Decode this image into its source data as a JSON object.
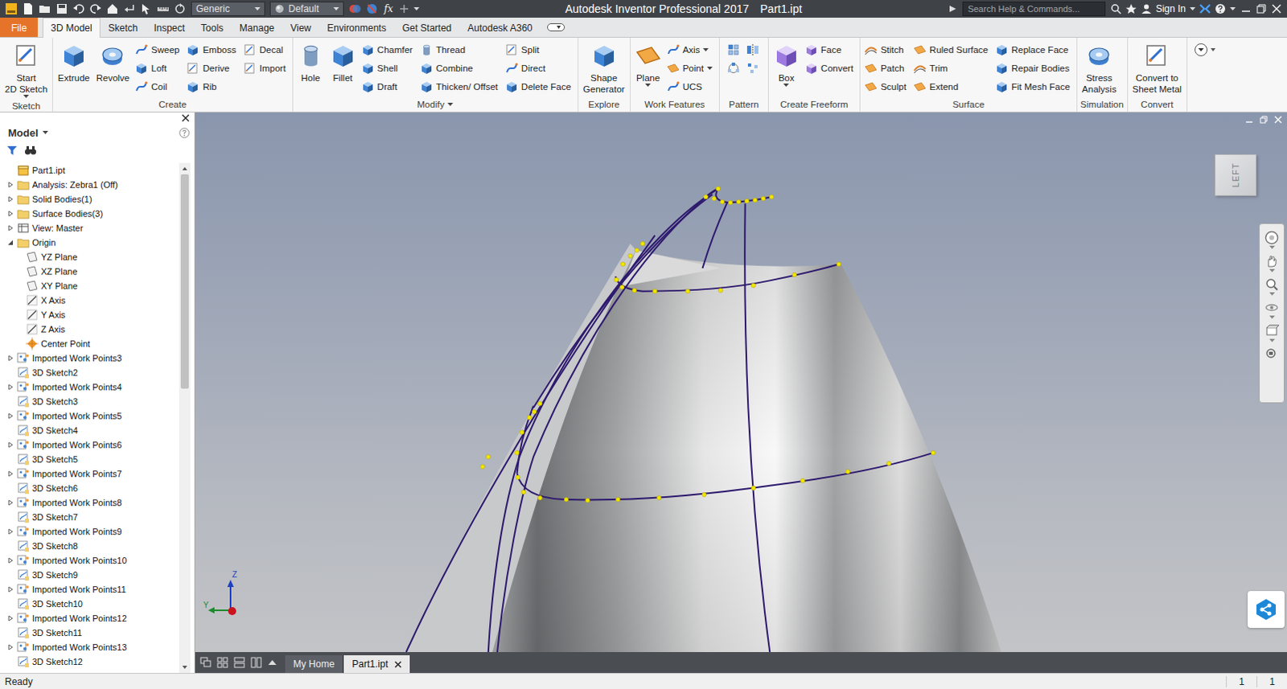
{
  "window": {
    "title": "Autodesk Inventor Professional 2017",
    "document": "Part1.ipt"
  },
  "quick_access": {
    "appearance": "Generic",
    "material": "Default",
    "formula": "fx"
  },
  "search": {
    "placeholder": "Search Help & Commands..."
  },
  "account": {
    "sign_in": "Sign In"
  },
  "menu_tabs": [
    {
      "label": "File",
      "kind": "file",
      "selected": false
    },
    {
      "label": "3D Model",
      "kind": "tab",
      "selected": true
    },
    {
      "label": "Sketch",
      "kind": "tab",
      "selected": false
    },
    {
      "label": "Inspect",
      "kind": "tab",
      "selected": false
    },
    {
      "label": "Tools",
      "kind": "tab",
      "selected": false
    },
    {
      "label": "Manage",
      "kind": "tab",
      "selected": false
    },
    {
      "label": "View",
      "kind": "tab",
      "selected": false
    },
    {
      "label": "Environments",
      "kind": "tab",
      "selected": false
    },
    {
      "label": "Get Started",
      "kind": "tab",
      "selected": false
    },
    {
      "label": "Autodesk A360",
      "kind": "tab",
      "selected": false
    }
  ],
  "ribbon": {
    "panels": [
      {
        "title": "Sketch",
        "menu": false,
        "groups": [
          {
            "kind": "large",
            "tools": [
              {
                "lines": [
                  "Start",
                  "2D Sketch"
                ],
                "dropdown": true
              }
            ]
          }
        ]
      },
      {
        "title": "Create",
        "menu": false,
        "groups": [
          {
            "kind": "large",
            "tools": [
              {
                "lines": [
                  "Extrude"
                ],
                "dropdown": false
              }
            ]
          },
          {
            "kind": "large",
            "tools": [
              {
                "lines": [
                  "Revolve"
                ],
                "dropdown": false
              }
            ]
          },
          {
            "kind": "column",
            "tools": [
              {
                "label": "Sweep",
                "dropdown": false
              },
              {
                "label": "Loft",
                "dropdown": false
              },
              {
                "label": "Coil",
                "dropdown": false
              }
            ]
          },
          {
            "kind": "column",
            "tools": [
              {
                "label": "Emboss",
                "dropdown": false
              },
              {
                "label": "Derive",
                "dropdown": false
              },
              {
                "label": "Rib",
                "dropdown": false
              }
            ]
          },
          {
            "kind": "column",
            "tools": [
              {
                "label": "Decal",
                "dropdown": false
              },
              {
                "label": "Import",
                "dropdown": false
              }
            ]
          }
        ]
      },
      {
        "title": "Modify",
        "menu": true,
        "groups": [
          {
            "kind": "large",
            "tools": [
              {
                "lines": [
                  "Hole"
                ],
                "dropdown": false
              }
            ]
          },
          {
            "kind": "large",
            "tools": [
              {
                "lines": [
                  "Fillet"
                ],
                "dropdown": false
              }
            ]
          },
          {
            "kind": "column",
            "tools": [
              {
                "label": "Chamfer",
                "dropdown": false
              },
              {
                "label": "Shell",
                "dropdown": false
              },
              {
                "label": "Draft",
                "dropdown": false
              }
            ]
          },
          {
            "kind": "column",
            "tools": [
              {
                "label": "Thread",
                "dropdown": false
              },
              {
                "label": "Combine",
                "dropdown": false
              },
              {
                "label": "Thicken/ Offset",
                "dropdown": false
              }
            ]
          },
          {
            "kind": "column",
            "tools": [
              {
                "label": "Split",
                "dropdown": false
              },
              {
                "label": "Direct",
                "dropdown": false
              },
              {
                "label": "Delete Face",
                "dropdown": false
              }
            ]
          }
        ]
      },
      {
        "title": "Explore",
        "menu": false,
        "groups": [
          {
            "kind": "large",
            "tools": [
              {
                "lines": [
                  "Shape",
                  "Generator"
                ],
                "dropdown": false
              }
            ]
          }
        ]
      },
      {
        "title": "Work Features",
        "menu": false,
        "groups": [
          {
            "kind": "large",
            "tools": [
              {
                "lines": [
                  "Plane"
                ],
                "dropdown": true
              }
            ]
          },
          {
            "kind": "column",
            "tools": [
              {
                "label": "Axis",
                "dropdown": true
              },
              {
                "label": "Point",
                "dropdown": true
              },
              {
                "label": "UCS",
                "dropdown": false
              }
            ]
          }
        ]
      },
      {
        "title": "Pattern",
        "menu": false,
        "groups": [
          {
            "kind": "icons",
            "tools": []
          }
        ]
      },
      {
        "title": "Create Freeform",
        "menu": false,
        "groups": [
          {
            "kind": "large",
            "tools": [
              {
                "lines": [
                  "Box"
                ],
                "dropdown": true
              }
            ]
          },
          {
            "kind": "column",
            "tools": [
              {
                "label": "Face",
                "dropdown": false
              },
              {
                "label": "Convert",
                "dropdown": false
              }
            ]
          }
        ]
      },
      {
        "title": "Surface",
        "menu": false,
        "groups": [
          {
            "kind": "column",
            "tools": [
              {
                "label": "Stitch",
                "dropdown": false
              },
              {
                "label": "Patch",
                "dropdown": false
              },
              {
                "label": "Sculpt",
                "dropdown": false
              }
            ]
          },
          {
            "kind": "column",
            "tools": [
              {
                "label": "Ruled Surface",
                "dropdown": false
              },
              {
                "label": "Trim",
                "dropdown": false
              },
              {
                "label": "Extend",
                "dropdown": false
              }
            ]
          },
          {
            "kind": "column",
            "tools": [
              {
                "label": "Replace Face",
                "dropdown": false
              },
              {
                "label": "Repair Bodies",
                "dropdown": false
              },
              {
                "label": "Fit Mesh Face",
                "dropdown": false
              }
            ]
          }
        ]
      },
      {
        "title": "Simulation",
        "menu": false,
        "groups": [
          {
            "kind": "large",
            "tools": [
              {
                "lines": [
                  "Stress",
                  "Analysis"
                ],
                "dropdown": false
              }
            ]
          }
        ]
      },
      {
        "title": "Convert",
        "menu": false,
        "groups": [
          {
            "kind": "large",
            "tools": [
              {
                "lines": [
                  "Convert to",
                  "Sheet Metal"
                ],
                "dropdown": false
              }
            ]
          }
        ]
      }
    ]
  },
  "browser": {
    "title": "Model",
    "scrollbar": {
      "level": 0.44
    },
    "items": [
      {
        "label": "Part1.ipt",
        "kind": "part"
      },
      {
        "label": "Analysis: Zebra1 (Off)",
        "kind": "folder",
        "expanded": false
      },
      {
        "label": "Solid Bodies(1)",
        "kind": "folder",
        "expanded": false
      },
      {
        "label": "Surface Bodies(3)",
        "kind": "folder",
        "expanded": false
      },
      {
        "label": "View: Master",
        "kind": "view",
        "expanded": false
      },
      {
        "label": "Origin",
        "kind": "folder",
        "expanded": true,
        "children": [
          {
            "label": "YZ Plane",
            "kind": "plane"
          },
          {
            "label": "XZ Plane",
            "kind": "plane"
          },
          {
            "label": "XY Plane",
            "kind": "plane"
          },
          {
            "label": "X Axis",
            "kind": "axis"
          },
          {
            "label": "Y Axis",
            "kind": "axis"
          },
          {
            "label": "Z Axis",
            "kind": "axis"
          },
          {
            "label": "Center Point",
            "kind": "point"
          }
        ]
      },
      {
        "label": "Imported Work Points3",
        "kind": "workpoints",
        "expanded": false
      },
      {
        "label": "3D Sketch2",
        "kind": "sketch"
      },
      {
        "label": "Imported Work Points4",
        "kind": "workpoints",
        "expanded": false
      },
      {
        "label": "3D Sketch3",
        "kind": "sketch"
      },
      {
        "label": "Imported Work Points5",
        "kind": "workpoints",
        "expanded": false
      },
      {
        "label": "3D Sketch4",
        "kind": "sketch"
      },
      {
        "label": "Imported Work Points6",
        "kind": "workpoints",
        "expanded": false
      },
      {
        "label": "3D Sketch5",
        "kind": "sketch"
      },
      {
        "label": "Imported Work Points7",
        "kind": "workpoints",
        "expanded": false
      },
      {
        "label": "3D Sketch6",
        "kind": "sketch"
      },
      {
        "label": "Imported Work Points8",
        "kind": "workpoints",
        "expanded": false
      },
      {
        "label": "3D Sketch7",
        "kind": "sketch"
      },
      {
        "label": "Imported Work Points9",
        "kind": "workpoints",
        "expanded": false
      },
      {
        "label": "3D Sketch8",
        "kind": "sketch"
      },
      {
        "label": "Imported Work Points10",
        "kind": "workpoints",
        "expanded": false
      },
      {
        "label": "3D Sketch9",
        "kind": "sketch"
      },
      {
        "label": "Imported Work Points11",
        "kind": "workpoints",
        "expanded": false
      },
      {
        "label": "3D Sketch10",
        "kind": "sketch"
      },
      {
        "label": "Imported Work Points12",
        "kind": "workpoints",
        "expanded": false
      },
      {
        "label": "3D Sketch11",
        "kind": "sketch"
      },
      {
        "label": "Imported Work Points13",
        "kind": "workpoints",
        "expanded": false
      },
      {
        "label": "3D Sketch12",
        "kind": "sketch"
      }
    ]
  },
  "viewport": {
    "view_cube": "LEFT",
    "axes": {
      "z": "Z",
      "y": "Y"
    }
  },
  "document_tabs": [
    {
      "label": "My Home",
      "selected": false,
      "closable": false
    },
    {
      "label": "Part1.ipt",
      "selected": true,
      "closable": true
    }
  ],
  "status_bar": {
    "message": "Ready",
    "counts": [
      "1",
      "1"
    ]
  }
}
